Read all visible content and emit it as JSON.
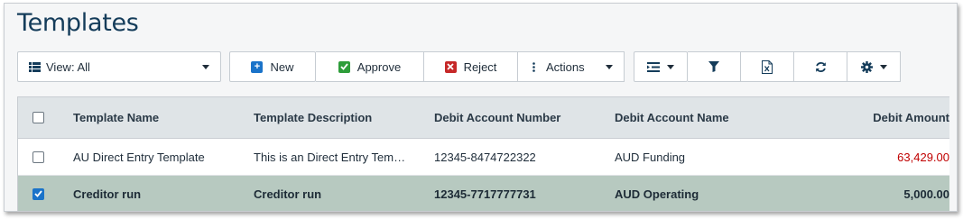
{
  "page": {
    "title": "Templates"
  },
  "toolbar": {
    "view_label": "View: All",
    "new_label": "New",
    "approve_label": "Approve",
    "reject_label": "Reject",
    "actions_label": "Actions"
  },
  "colors": {
    "title": "#143c5a",
    "new_icon": "#1a73c9",
    "approve_icon": "#2e9d3a",
    "reject_icon": "#c62828",
    "amount": "#c00000",
    "selected_row": "#b7c9c0",
    "header_bg": "#dfe4e7"
  },
  "table": {
    "columns": [
      "Template Name",
      "Template Description",
      "Debit Account Number",
      "Debit Account Name",
      "Debit Amount"
    ],
    "rows": [
      {
        "checked": false,
        "name": "AU Direct Entry Template",
        "description": "This is an Direct Entry Tem…",
        "account_number": "12345-8474722322",
        "account_name": "AUD Funding",
        "amount": "63,429.00"
      },
      {
        "checked": true,
        "name": "Creditor run",
        "description": "Creditor run",
        "account_number": "12345-7717777731",
        "account_name": "AUD Operating",
        "amount": "5,000.00"
      }
    ]
  },
  "icons": {
    "view": "list-icon",
    "new": "plus-square-icon",
    "approve": "check-square-icon",
    "reject": "x-square-icon",
    "actions": "vertical-ellipsis-icon",
    "columns": "columns-list-icon",
    "filter": "filter-icon",
    "export": "excel-export-icon",
    "refresh": "refresh-icon",
    "settings": "gear-icon"
  }
}
